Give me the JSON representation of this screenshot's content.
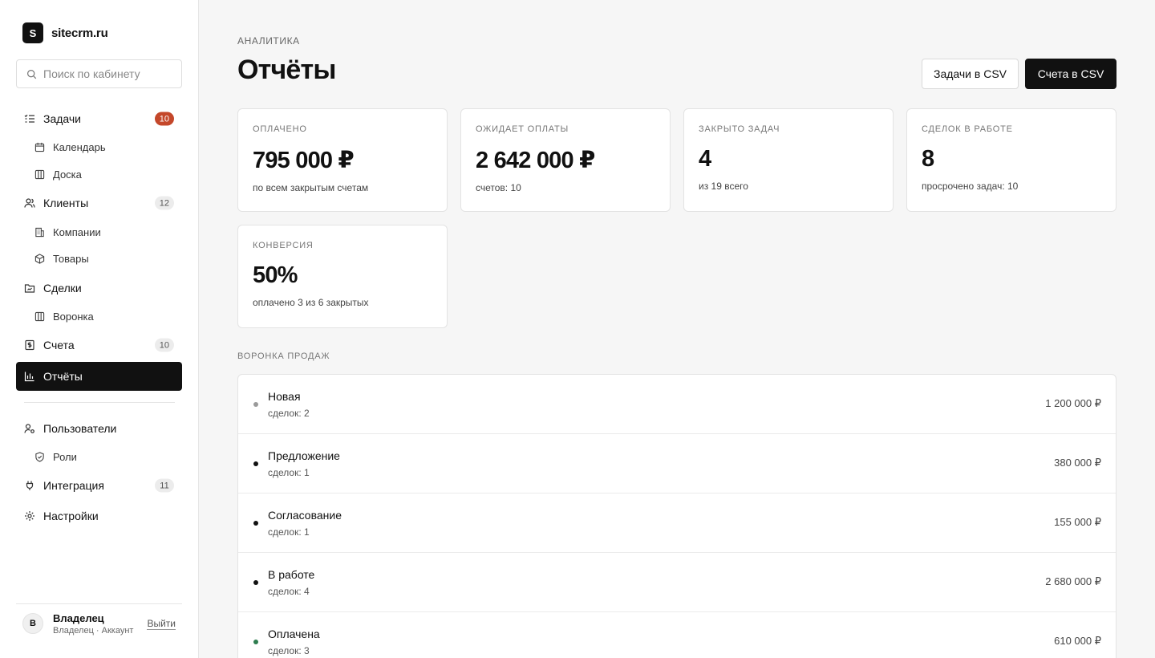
{
  "brand": {
    "logo_letter": "S",
    "name": "sitecrm.ru"
  },
  "search": {
    "placeholder": "Поиск по кабинету"
  },
  "sidebar": {
    "items": [
      {
        "label": "Задачи",
        "icon": "tasks-list-icon",
        "badge": "10"
      },
      {
        "label": "Календарь",
        "icon": "calendar-icon"
      },
      {
        "label": "Доска",
        "icon": "board-columns-icon"
      },
      {
        "label": "Клиенты",
        "icon": "users-icon",
        "badge": "12"
      },
      {
        "label": "Компании",
        "icon": "building-icon"
      },
      {
        "label": "Товары",
        "icon": "box-icon"
      },
      {
        "label": "Сделки",
        "icon": "folder-icon"
      },
      {
        "label": "Воронка",
        "icon": "board-columns-icon"
      },
      {
        "label": "Счета",
        "icon": "invoice-icon",
        "badge": "10"
      },
      {
        "label": "Отчёты",
        "icon": "bar-chart-icon"
      },
      {
        "label": "Пользователи",
        "icon": "user-settings-icon"
      },
      {
        "label": "Роли",
        "icon": "shield-check-icon"
      },
      {
        "label": "Интеграция",
        "icon": "plug-icon",
        "badge": "11"
      },
      {
        "label": "Настройки",
        "icon": "gear-icon"
      }
    ]
  },
  "user": {
    "avatar": "В",
    "name": "Владелец",
    "subtitle": "Владелец · Аккаунт",
    "logout": "Выйти"
  },
  "header": {
    "breadcrumb": "АНАЛИТИКА",
    "title": "Отчёты",
    "export_tasks": "Задачи в CSV",
    "export_invoices": "Счета в CSV"
  },
  "stats": [
    {
      "label": "ОПЛАЧЕНО",
      "value": "795 000 ₽",
      "sub": "по всем закрытым счетам"
    },
    {
      "label": "ОЖИДАЕТ ОПЛАТЫ",
      "value": "2 642 000 ₽",
      "sub": "счетов: 10"
    },
    {
      "label": "ЗАКРЫТО ЗАДАЧ",
      "value": "4",
      "sub": "из 19 всего"
    },
    {
      "label": "СДЕЛОК В РАБОТЕ",
      "value": "8",
      "sub": "просрочено задач: 10"
    },
    {
      "label": "КОНВЕРСИЯ",
      "value": "50%",
      "sub": "оплачено 3 из 6 закрытых"
    }
  ],
  "funnel": {
    "label": "ВОРОНКА ПРОДАЖ",
    "stages": [
      {
        "name": "Новая",
        "count": "сделок: 2",
        "amount": "1 200 000 ₽",
        "color": "#9a9a9a"
      },
      {
        "name": "Предложение",
        "count": "сделок: 1",
        "amount": "380 000 ₽",
        "color": "#111111"
      },
      {
        "name": "Согласование",
        "count": "сделок: 1",
        "amount": "155 000 ₽",
        "color": "#111111"
      },
      {
        "name": "В работе",
        "count": "сделок: 4",
        "amount": "2 680 000 ₽",
        "color": "#111111"
      },
      {
        "name": "Оплачена",
        "count": "сделок: 3",
        "amount": "610 000 ₽",
        "color": "#2e7d4f"
      }
    ]
  }
}
